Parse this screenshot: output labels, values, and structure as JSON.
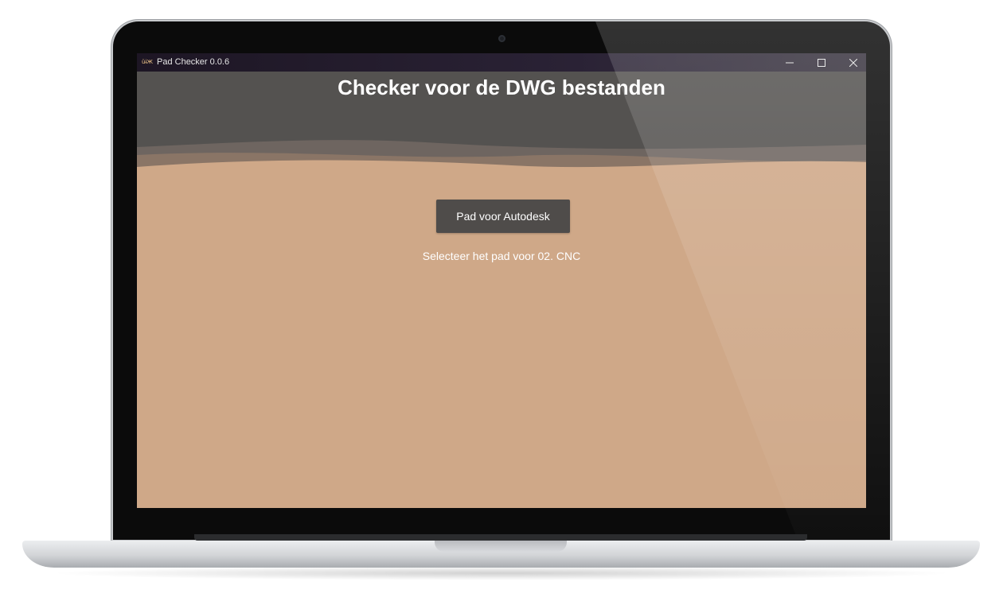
{
  "window": {
    "title": "Pad Checker 0.0.6",
    "icon_text": "üɨЖ",
    "controls": {
      "minimize": "minimize-icon",
      "maximize": "maximize-icon",
      "close": "close-icon"
    }
  },
  "main": {
    "heading": "Checker voor de DWG bestanden",
    "button_label": "Pad voor Autodesk",
    "hint": "Selecteer het pad voor 02. CNC"
  },
  "colors": {
    "body": "#cfa888",
    "header": "#545250",
    "button": "#4f4c4a",
    "titlebar": "#1d1624"
  }
}
